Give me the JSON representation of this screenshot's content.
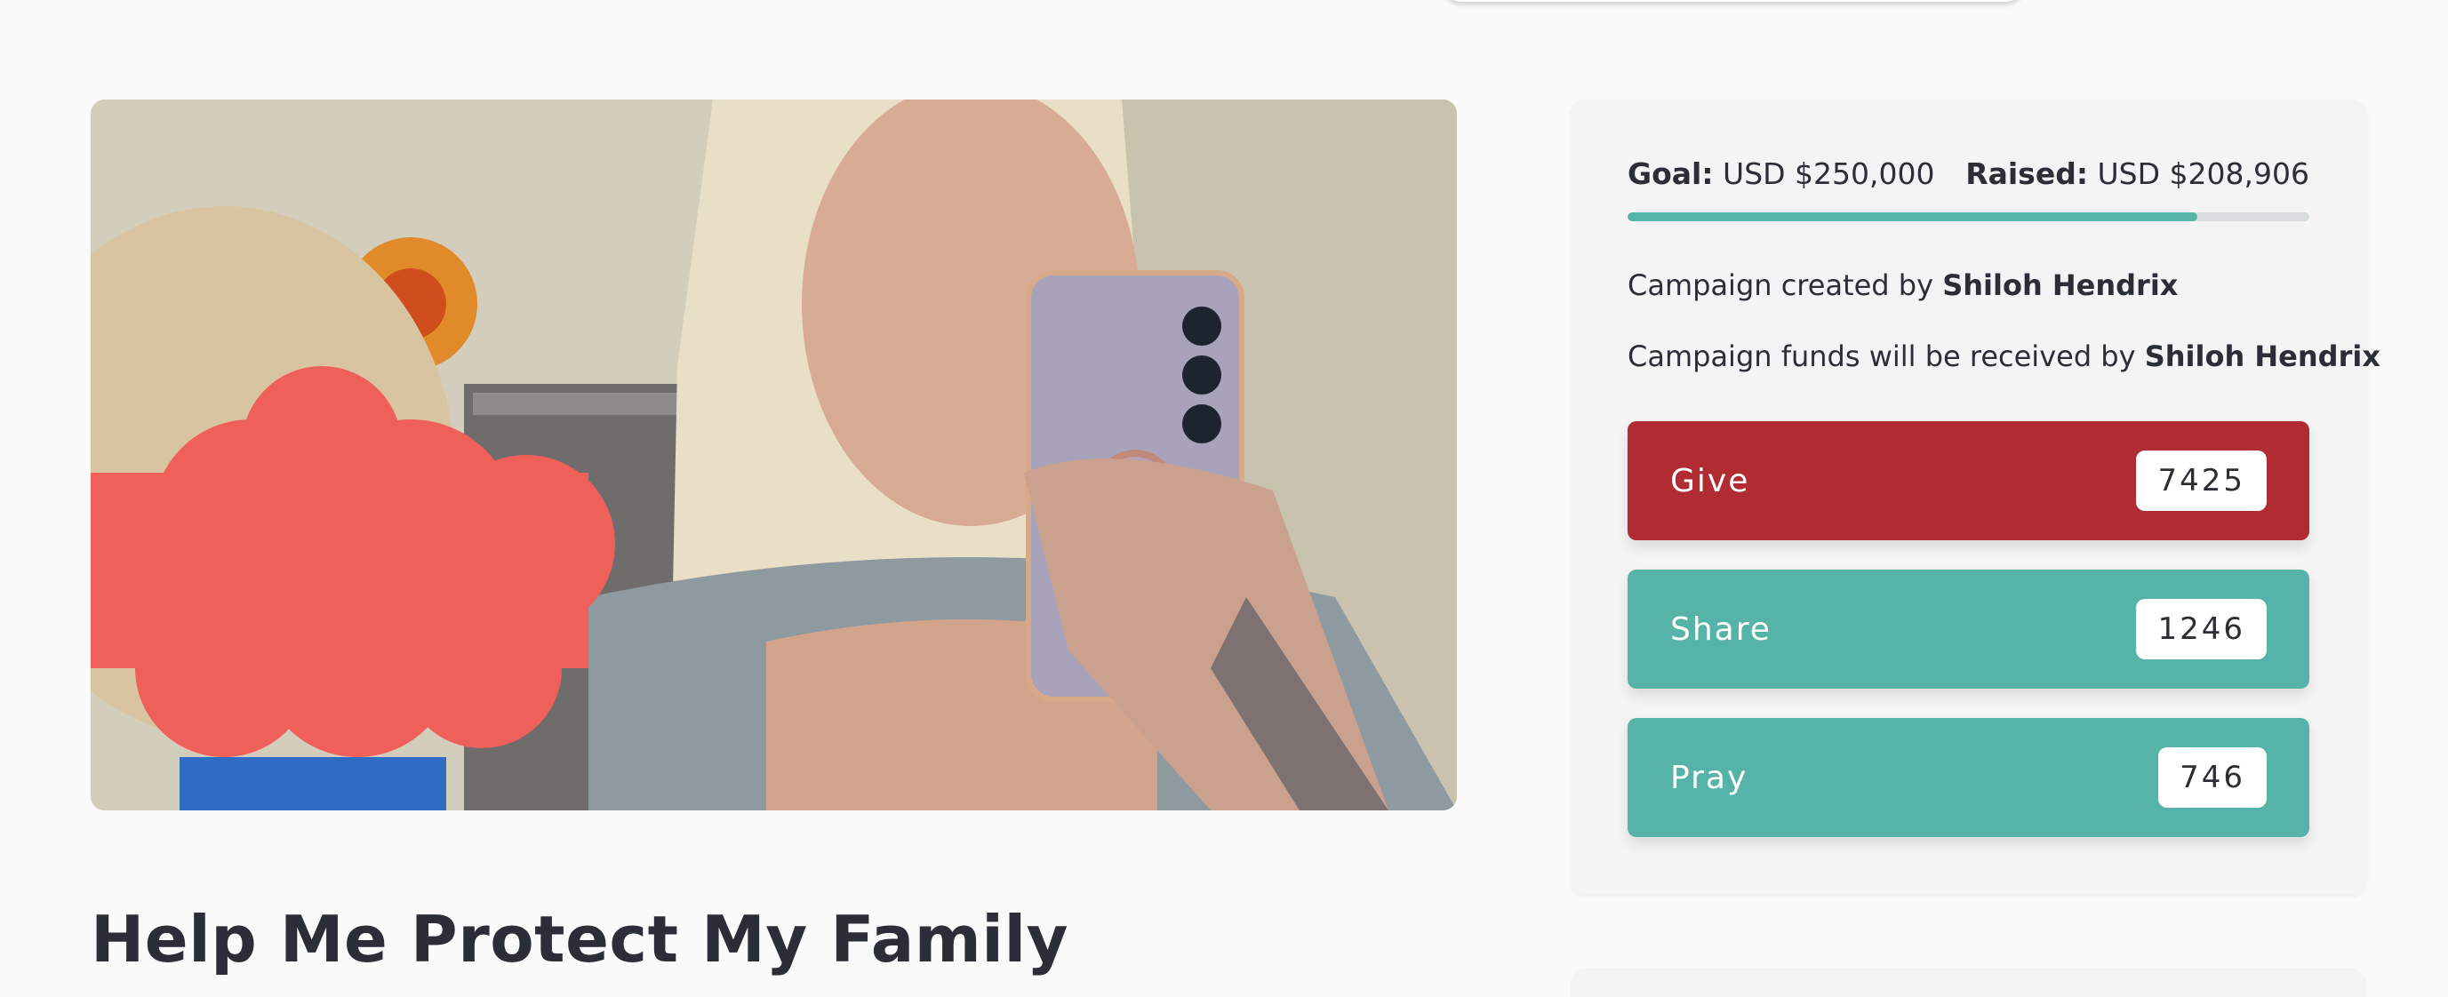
{
  "campaign": {
    "title": "Help Me Protect My Family",
    "image_alt": "Campaign photo"
  },
  "card": {
    "goal_label": "Goal:",
    "goal_value": "USD $250,000",
    "raised_label": "Raised:",
    "raised_value": "USD $208,906",
    "progress_fraction": 0.8356,
    "created_by_prefix": "Campaign created by",
    "created_by_name": "Shiloh Hendrix",
    "funds_prefix": "Campaign funds will be received by",
    "funds_name": "Shiloh Hendrix"
  },
  "actions": {
    "give": {
      "label": "Give",
      "count": "7425"
    },
    "share": {
      "label": "Share",
      "count": "1246"
    },
    "pray": {
      "label": "Pray",
      "count": "746"
    }
  },
  "colors": {
    "give": "#b02c32",
    "teal": "#56b3a8",
    "redaction": "#f0605a"
  }
}
